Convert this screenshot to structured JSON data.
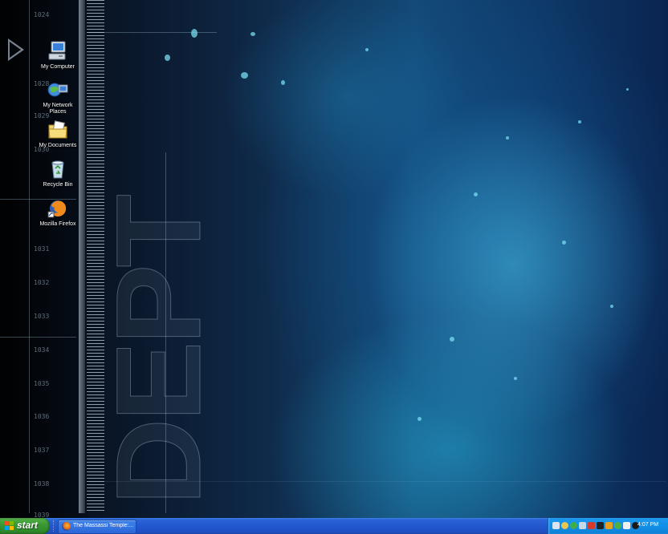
{
  "desktop": {
    "icons": [
      {
        "label": "My Computer",
        "icon": "my-computer-icon"
      },
      {
        "label": "My Network Places",
        "icon": "network-places-icon"
      },
      {
        "label": "My Documents",
        "icon": "my-documents-icon"
      },
      {
        "label": "Recycle Bin",
        "icon": "recycle-bin-icon"
      },
      {
        "label": "Mozilla Firefox",
        "icon": "firefox-icon"
      }
    ],
    "depth_markers": [
      "1024",
      "1028",
      "1029",
      "1030",
      "1031",
      "1032",
      "1033",
      "1034",
      "1035",
      "1036",
      "1037",
      "1038",
      "1039"
    ],
    "wallpaper_text": "DEPT"
  },
  "taskbar": {
    "start_label": "start",
    "tasks": [
      {
        "label": "The Massassi Temple:...",
        "icon": "firefox-icon"
      }
    ],
    "tray_icons": [
      "network-icon",
      "volume-icon",
      "security-icon",
      "monitor-icon",
      "antivirus-icon",
      "display-icon",
      "update-icon",
      "messenger-icon",
      "shield-icon",
      "sound-icon",
      "tray-misc-icon"
    ],
    "clock": "4:07 PM"
  },
  "colors": {
    "taskbar_blue": "#2357cf",
    "start_green": "#3a9a34",
    "tray_blue": "#1290e8"
  }
}
